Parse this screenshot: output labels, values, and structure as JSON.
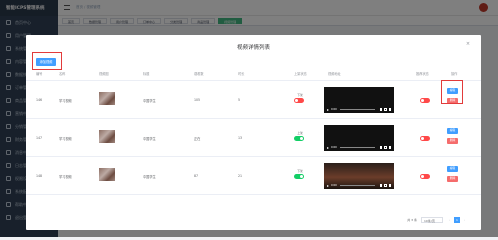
{
  "app": {
    "logo": "智能ICPS管理系统"
  },
  "sidebar": {
    "items": [
      "首页中心",
      "用户管理",
      "系统管理",
      "内容管理",
      "数据统计",
      "订单管理",
      "商品管理",
      "营销中心",
      "分销管理",
      "财务管理",
      "消息中心",
      "日志管理",
      "权限设置",
      "系统配置",
      "帮助中心",
      "退出登录"
    ]
  },
  "breadcrumb": "首页 / 视频管理",
  "tabs": [
    {
      "label": "首页"
    },
    {
      "label": "数据管理"
    },
    {
      "label": "用户管理"
    },
    {
      "label": "订单中心"
    },
    {
      "label": "分类管理"
    },
    {
      "label": "商品管理"
    },
    {
      "label": "视频管理",
      "active": true
    }
  ],
  "modal": {
    "title": "视频详情列表",
    "close_icon": "×",
    "add_label": "添加视频",
    "columns": [
      "编号",
      "名称",
      "视频图",
      "标题",
      "观看数",
      "时长",
      "上架状态",
      "视频地址",
      "推荐状态",
      "操作"
    ],
    "rows": [
      {
        "id": "146",
        "name": "学习视频",
        "title": "中国学生",
        "views": "105",
        "duration": "5",
        "status": "下架",
        "status_on": false,
        "video": {
          "time": "0:00",
          "style": "dark"
        },
        "recommend_on": false
      },
      {
        "id": "147",
        "name": "学习视频",
        "title": "中国学生",
        "views": "正在",
        "duration": "13",
        "status": "上架",
        "status_on": true,
        "video": {
          "time": "0:00",
          "style": "dark"
        },
        "recommend_on": false
      },
      {
        "id": "148",
        "name": "学习视频",
        "title": "中国学生",
        "views": "87",
        "duration": "21",
        "status": "下架",
        "status_on": true,
        "video": {
          "time": "0:00",
          "style": "scene"
        },
        "recommend_on": false
      }
    ],
    "edit_label": "编辑",
    "delete_label": "删除",
    "pagination": {
      "total": "共 3 条",
      "page_size": "10条/页",
      "prev": "‹",
      "page": "1",
      "next": "›"
    }
  }
}
